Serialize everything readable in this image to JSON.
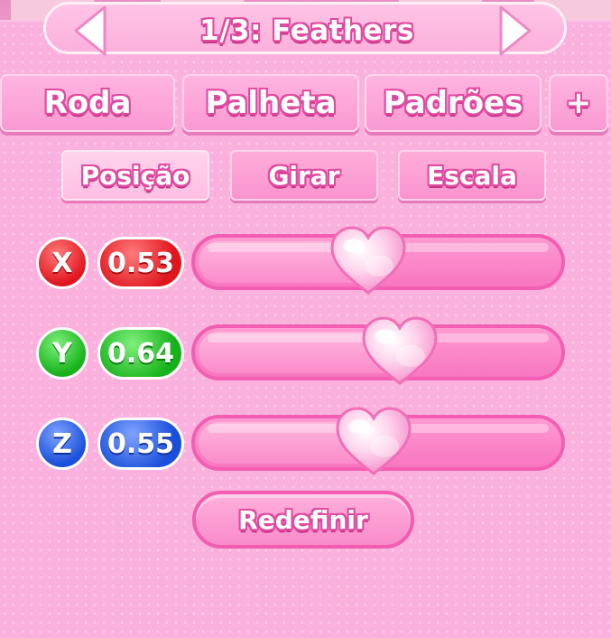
{
  "header": {
    "title": "1/3: Feathers",
    "prev_icon": "arrow-left-icon",
    "next_icon": "arrow-right-icon"
  },
  "tabs": [
    {
      "label": "Roda"
    },
    {
      "label": "Palheta"
    },
    {
      "label": "Padrões"
    },
    {
      "label": "+"
    }
  ],
  "subtabs": [
    {
      "label": "Posição",
      "active": true
    },
    {
      "label": "Girar",
      "active": false
    },
    {
      "label": "Escala",
      "active": false
    }
  ],
  "sliders": [
    {
      "axis": "X",
      "value": "0.53",
      "level": 0.53,
      "color": "#e0161f"
    },
    {
      "axis": "Y",
      "value": "0.64",
      "level": 0.64,
      "color": "#17b21b"
    },
    {
      "axis": "Z",
      "value": "0.55",
      "level": 0.55,
      "color": "#1a4fd9"
    }
  ],
  "reset_label": "Redefinir",
  "colors": {
    "panel": "#fbb1dd",
    "accent": "#e04aa0",
    "track": "#f776c0"
  }
}
